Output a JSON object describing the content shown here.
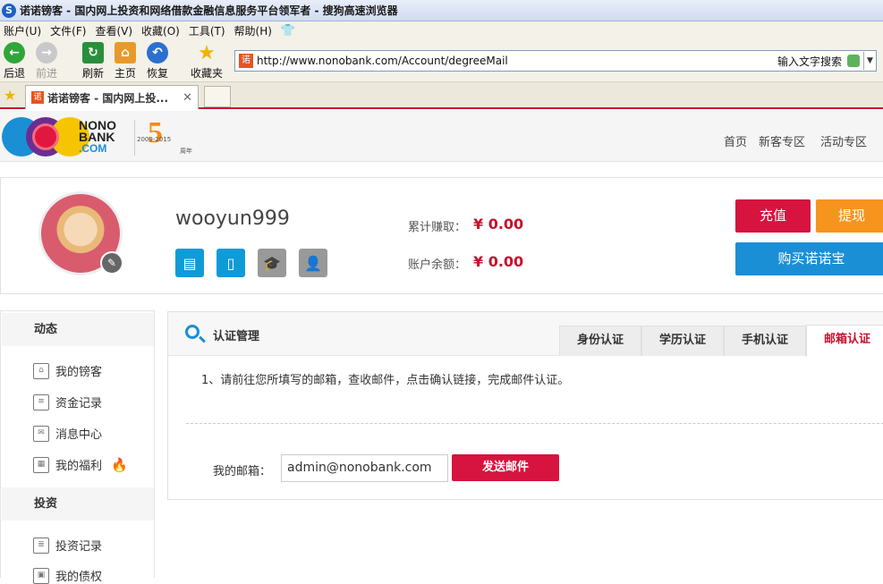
{
  "browser": {
    "title": "诺诺镑客 - 国内网上投资和网络借款金融信息服务平台领军者 - 搜狗高速浏览器",
    "menu": [
      "账户(U)",
      "文件(F)",
      "查看(V)",
      "收藏(O)",
      "工具(T)",
      "帮助(H)"
    ],
    "toolbar": {
      "back": "后退",
      "forward": "前进",
      "refresh": "刷新",
      "home": "主页",
      "restore": "恢复",
      "favorites": "收藏夹"
    },
    "url": "http://www.nonobank.com/Account/degreeMail",
    "search_label": "输入文字搜索",
    "tab_title": "诺诺镑客 - 国内网上投...",
    "favicon": "诺"
  },
  "site": {
    "brand_line1": "NONO",
    "brand_line2": "BANK",
    "brand_line3": ".COM",
    "anniv_number": "5",
    "anniv_range": "2009-2015",
    "anniv_suffix": "周年",
    "nav": [
      "首页",
      "新客专区",
      "活动专区"
    ]
  },
  "account": {
    "username": "wooyun999",
    "earned_label": "累计赚取：",
    "earned_value": "¥ 0.00",
    "balance_label": "账户余额：",
    "balance_value": "¥ 0.00",
    "recharge": "充值",
    "withdraw": "提现",
    "buy": "购买诺诺宝"
  },
  "sidebar": {
    "section1": "动态",
    "items1": [
      "我的镑客",
      "资金记录",
      "消息中心",
      "我的福利"
    ],
    "section2": "投资",
    "items2": [
      "投资记录",
      "我的债权"
    ]
  },
  "main": {
    "title": "认证管理",
    "tabs": [
      "身份认证",
      "学历认证",
      "手机认证",
      "邮箱认证"
    ],
    "note": "1、请前往您所填写的邮箱，查收邮件，点击确认链接，完成邮件认证。",
    "email_label": "我的邮箱：",
    "email_value": "admin@nonobank.com",
    "send": "发送邮件"
  },
  "colors": {
    "accent": "#c8102e",
    "blue": "#1a8fd6",
    "orange": "#f7941d"
  }
}
